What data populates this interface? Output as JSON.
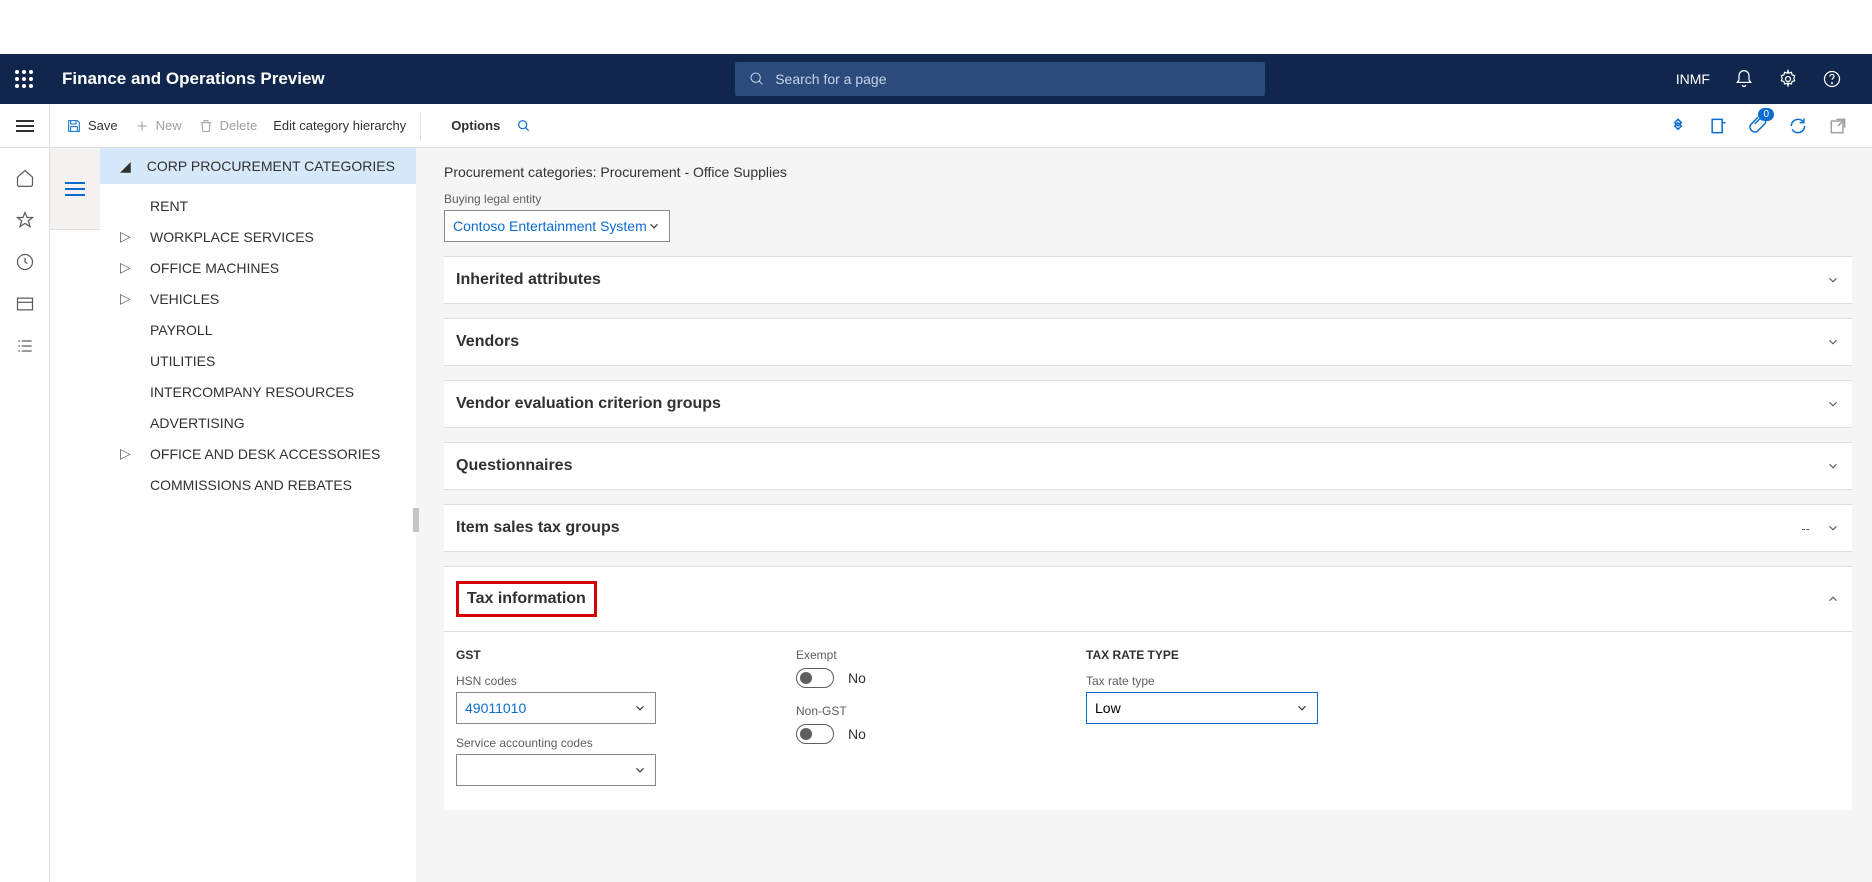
{
  "navbar": {
    "title": "Finance and Operations Preview",
    "search_placeholder": "Search for a page",
    "company": "INMF"
  },
  "toolbar": {
    "save": "Save",
    "new": "New",
    "delete": "Delete",
    "edit_hierarchy": "Edit category hierarchy",
    "options": "Options",
    "badge_count": "0"
  },
  "tree": {
    "root": "CORP PROCUREMENT CATEGORIES",
    "items": [
      {
        "label": "RENT",
        "expandable": false
      },
      {
        "label": "WORKPLACE SERVICES",
        "expandable": true
      },
      {
        "label": "OFFICE MACHINES",
        "expandable": true
      },
      {
        "label": "VEHICLES",
        "expandable": true
      },
      {
        "label": "PAYROLL",
        "expandable": false
      },
      {
        "label": "UTILITIES",
        "expandable": false
      },
      {
        "label": "INTERCOMPANY RESOURCES",
        "expandable": false
      },
      {
        "label": "ADVERTISING",
        "expandable": false
      },
      {
        "label": "OFFICE AND DESK ACCESSORIES",
        "expandable": true
      },
      {
        "label": "COMMISSIONS AND REBATES",
        "expandable": false
      }
    ]
  },
  "main": {
    "title": "Procurement categories: Procurement - Office Supplies",
    "legal_entity_label": "Buying legal entity",
    "legal_entity_value": "Contoso Entertainment System",
    "sections": {
      "inherited": "Inherited attributes",
      "vendors": "Vendors",
      "criterion": "Vendor evaluation criterion groups",
      "questionnaires": "Questionnaires",
      "salestax": "Item sales tax groups",
      "salestax_extra": "--",
      "taxinfo": "Tax information"
    },
    "tax": {
      "gst_label": "GST",
      "hsn_label": "HSN codes",
      "hsn_value": "49011010",
      "sac_label": "Service accounting codes",
      "exempt_label": "Exempt",
      "exempt_value": "No",
      "nongst_label": "Non-GST",
      "nongst_value": "No",
      "ratetype_group": "TAX RATE TYPE",
      "ratetype_label": "Tax rate type",
      "ratetype_value": "Low"
    }
  }
}
